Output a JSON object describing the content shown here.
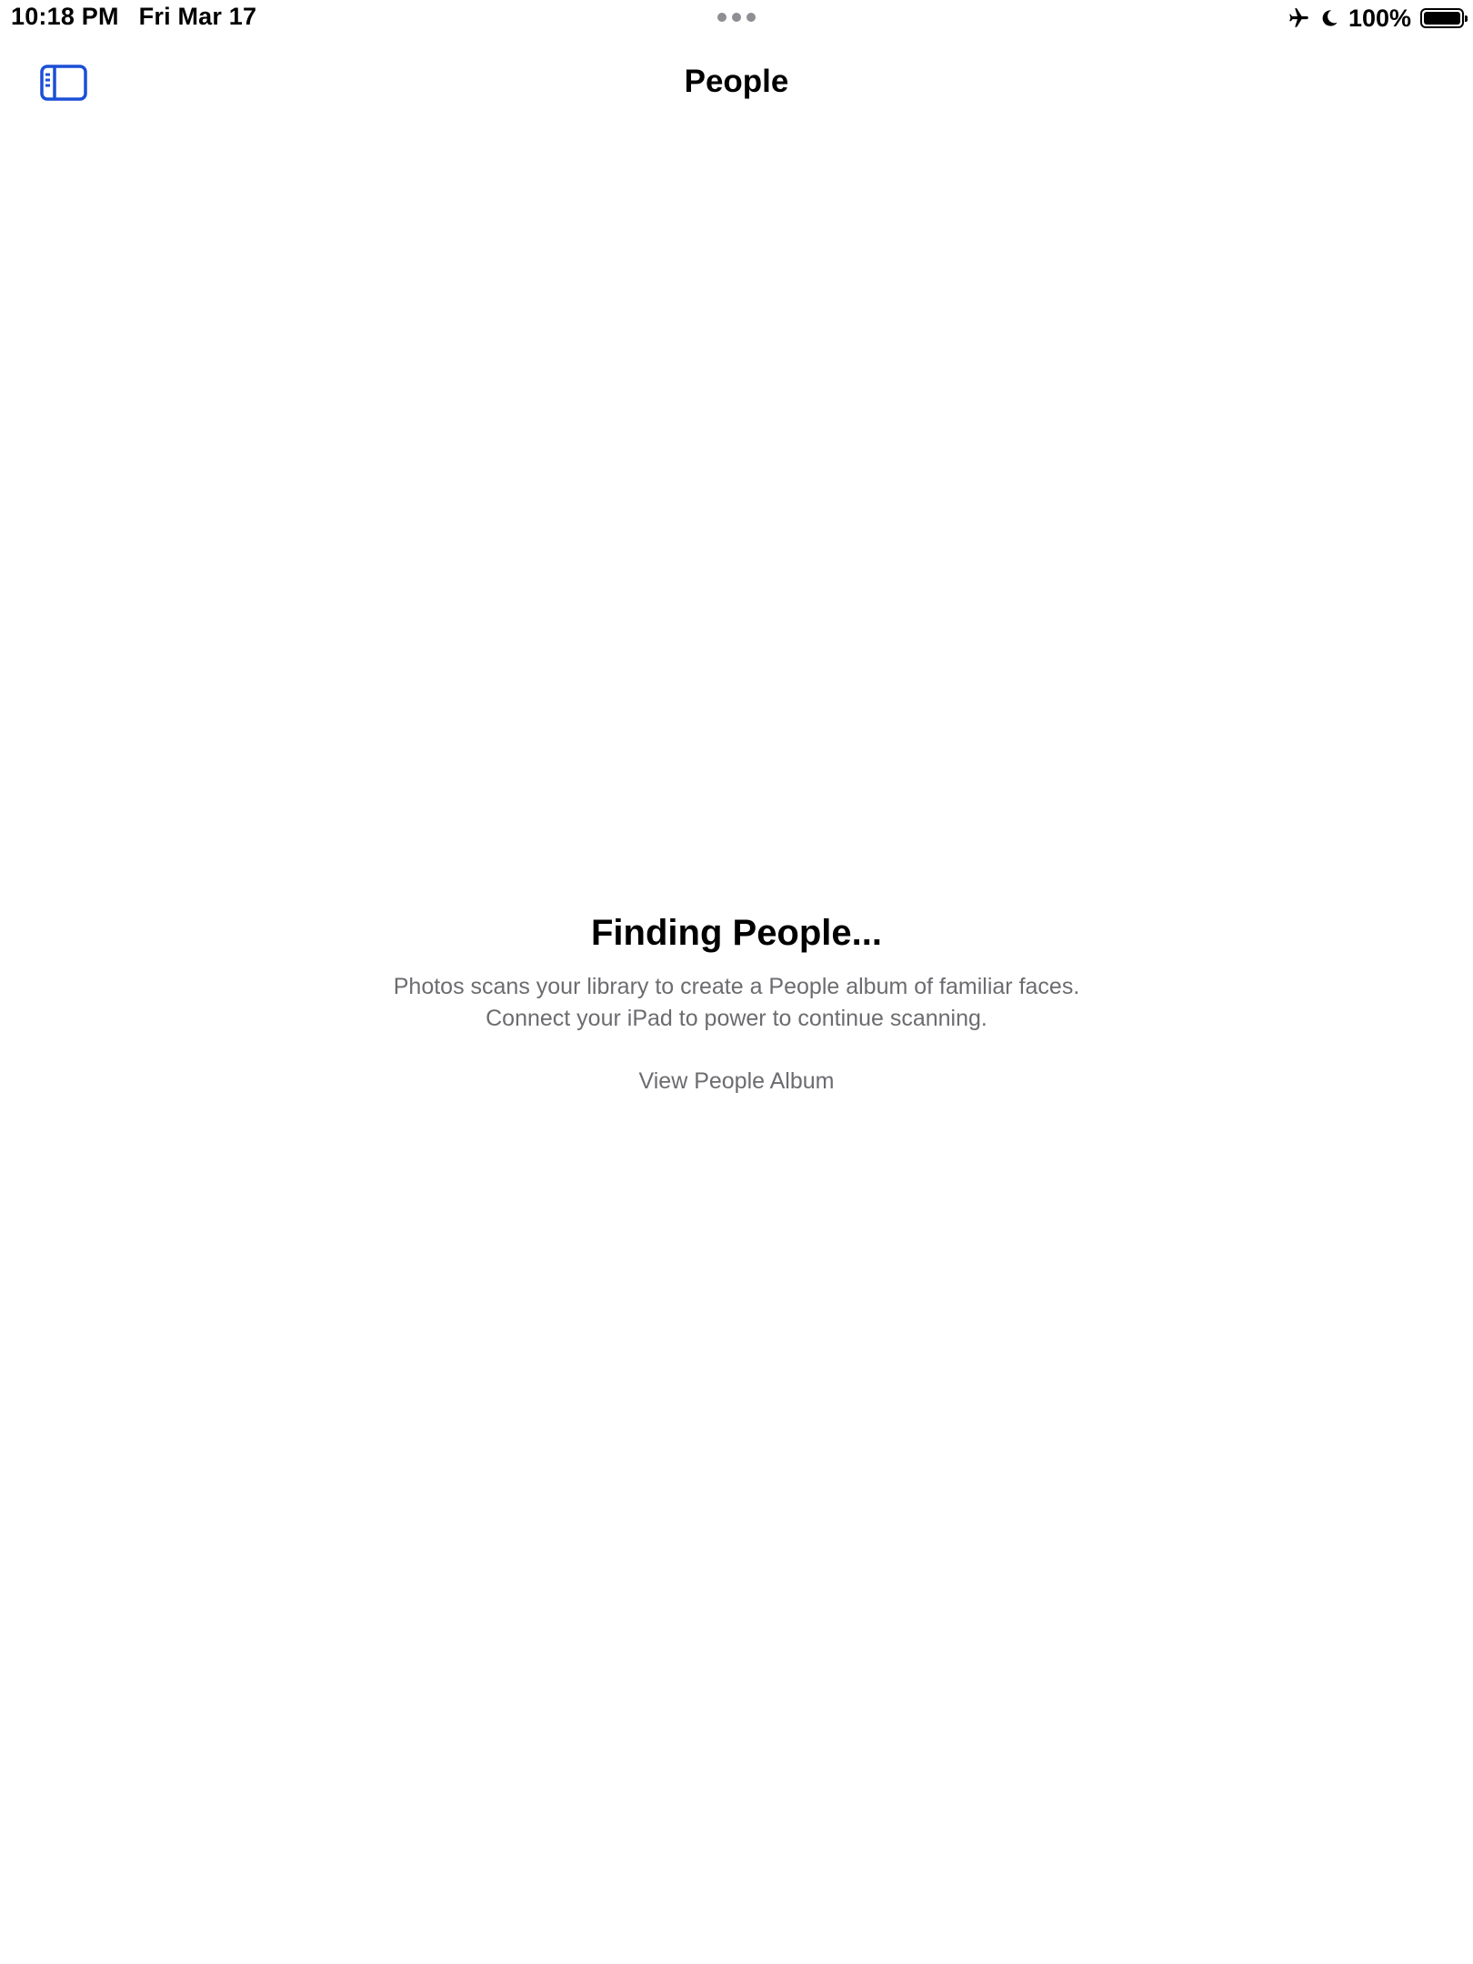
{
  "status_bar": {
    "time": "10:18 PM",
    "date": "Fri Mar 17",
    "battery_percent": "100%",
    "battery_level": 1.0,
    "icons": [
      "airplane-icon",
      "moon-icon",
      "battery-icon"
    ]
  },
  "nav": {
    "title": "People",
    "sidebar_icon": "sidebar-toggle-icon"
  },
  "empty_state": {
    "title": "Finding People...",
    "message_line1": "Photos scans your library to create a People album of familiar faces.",
    "message_line2": "Connect your iPad to power to continue scanning.",
    "action_label": "View People Album"
  },
  "colors": {
    "accent": "#1c4fd6",
    "secondary_text": "#6c6c70",
    "background": "#ffffff"
  }
}
